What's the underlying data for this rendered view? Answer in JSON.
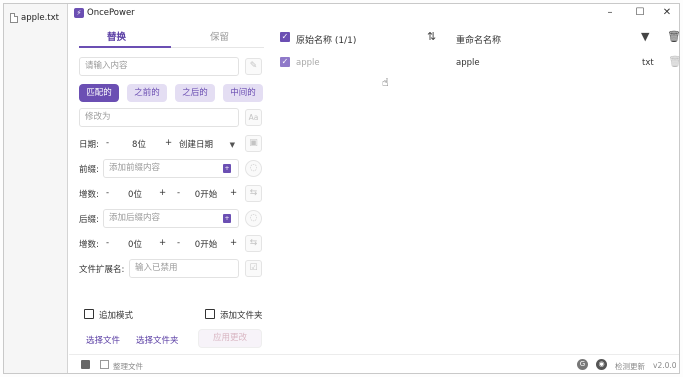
{
  "desktop": {
    "file_label": "apple.txt"
  },
  "window": {
    "title": "OncePower",
    "logo_char": "⚡",
    "minimize": "–",
    "maximize": "☐",
    "close": "✕"
  },
  "tabs": {
    "replace": "替换",
    "keep": "保留"
  },
  "replace_panel": {
    "search_placeholder": "请输入内容",
    "modes": [
      "匹配的",
      "之前的",
      "之后的",
      "中间的"
    ],
    "replace_placeholder": "修改为",
    "case_btn": "Aa",
    "date_label": "日期:",
    "date_minus": "-",
    "date_value": "8位",
    "date_plus": "+",
    "date_select": "创建日期",
    "prefix_label": "前缀:",
    "prefix_placeholder": "添加前缀内容",
    "inc1_label": "增数:",
    "inc1_digits": "0位",
    "inc1_start": "0开始",
    "suffix_label": "后缀:",
    "suffix_placeholder": "添加后缀内容",
    "inc2_label": "增数:",
    "inc2_digits": "0位",
    "inc2_start": "0开始",
    "ext_label": "文件扩展名:",
    "ext_placeholder": "输入已禁用",
    "append_mode": "追加模式",
    "add_folder": "添加文件夹",
    "select_file": "选择文件",
    "select_folder": "选择文件夹",
    "apply": "应用更改"
  },
  "footer": {
    "organize_files": "整理文件",
    "check_update": "检测更新",
    "version": "v2.0.0"
  },
  "table": {
    "original_header": "原始名称 (1/1)",
    "renamed_header": "重命名名称",
    "rows": [
      {
        "original": "apple",
        "renamed": "apple",
        "ext": "txt"
      }
    ]
  },
  "colors": {
    "accent": "#6b4fb3",
    "accent_light": "#e4def3"
  }
}
